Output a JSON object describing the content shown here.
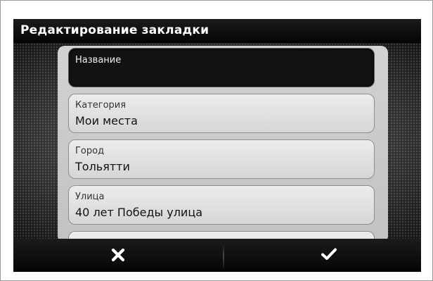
{
  "screen": {
    "title": "Редактирование закладки"
  },
  "fields": [
    {
      "label": "Название",
      "value": "",
      "active": true
    },
    {
      "label": "Категория",
      "value": "Мои места"
    },
    {
      "label": "Город",
      "value": "Тольятти"
    },
    {
      "label": "Улица",
      "value": "40 лет Победы улица"
    }
  ],
  "actions": {
    "cancel_icon": "close-icon",
    "confirm_icon": "checkmark-icon"
  },
  "colors": {
    "bar_background": "#0a0a0a",
    "panel_background": "#c8c8c8",
    "active_field": "#121212",
    "icon": "#ffffff"
  }
}
